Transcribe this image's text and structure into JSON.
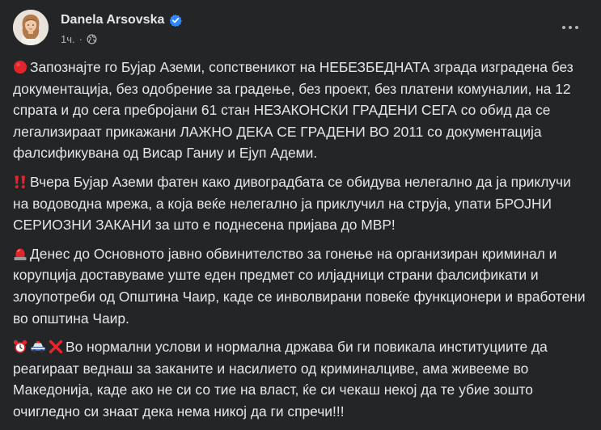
{
  "post": {
    "author": "Danela Arsovska",
    "time": "1ч.",
    "paragraphs": [
      {
        "emojis": [
          "red-circle-icon"
        ],
        "text": "Запознајте го Бујар Аземи, сопственикот на НЕБЕЗБЕДНАТА зграда изградена без документација, без одобрение за градење, без проект, без платени комуналии, на 12 спрата и до сега пребројани 61 стан НЕЗАКОНСКИ ГРАДЕНИ СЕГА со обид да се легализираат прикажани ЛАЖНО ДЕКА СЕ ГРАДЕНИ ВО 2011 со документација фалсификувана од Висар Ганиу и Ејуп Адеми."
      },
      {
        "emojis": [
          "double-exclamation-icon"
        ],
        "text": "Вчера Бујар Аземи фатен како дивоградбата се обидува нелегално да ја приклучи на водоводна мрежа, а која веќе нелегално ја приклучил на струја, упати БРОЈНИ СЕРИОЗНИ ЗАКАНИ за што е поднесена пријава до МВР!"
      },
      {
        "emojis": [
          "siren-icon"
        ],
        "text": "Денес до Основното јавно обвинителство за гонење на организиран криминал и корупција доставуваме уште еден предмет со илјадници страни фалсификати и злоупотреби од Општина Чаир, каде се инволвирани повеќе функционери и вработени во општина Чаир."
      },
      {
        "emojis": [
          "alarm-clock-icon",
          "police-car-icon",
          "cross-mark-icon"
        ],
        "text": "Во нормални услови и нормална држава би ги повикала институциите да реагираат веднаш за заканите и насилието од криминалциве, ама живееме во Македонија, каде ако не си со тие на власт, ќе си чекаш некој да те убие зошто очигледно си знаат дека нема никој да ги спречи!!!"
      }
    ]
  },
  "colors": {
    "background": "#242526",
    "text": "#e4e6eb",
    "secondary_text": "#b0b3b8",
    "verified_blue": "#2d88ff"
  }
}
